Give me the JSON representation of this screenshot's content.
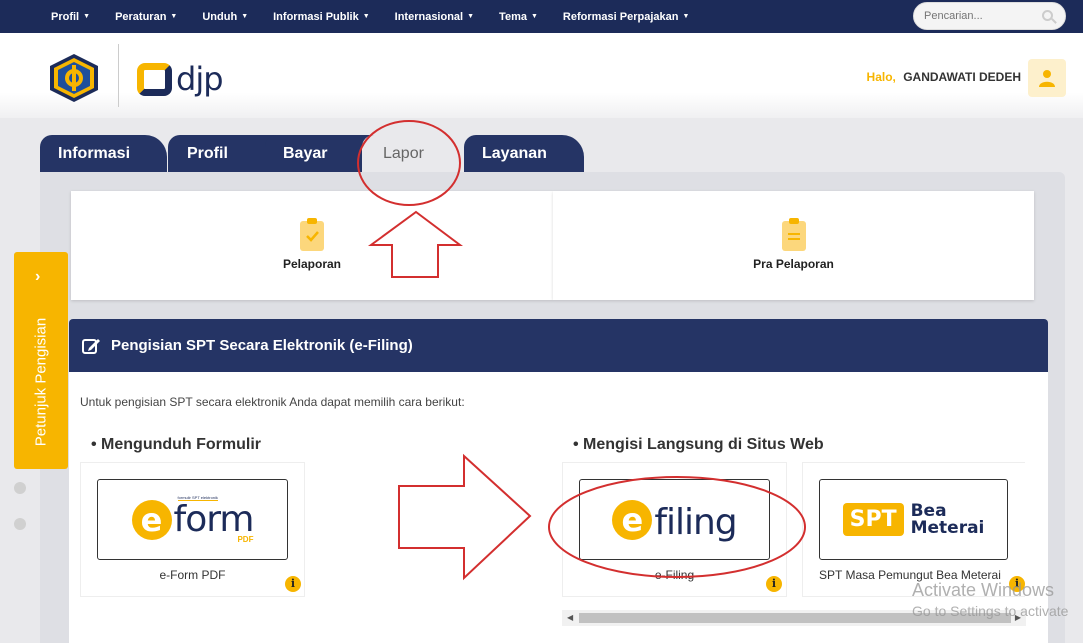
{
  "topnav": {
    "items": [
      "Profil",
      "Peraturan",
      "Unduh",
      "Informasi Publik",
      "Internasional",
      "Tema",
      "Reformasi Perpajakan"
    ],
    "search_placeholder": "Pencarian..."
  },
  "header": {
    "logo_text": "djp",
    "greeting": "Halo,",
    "user_name": "GANDAWATI DEDEH"
  },
  "tabs": [
    "Informasi",
    "Profil",
    "Bayar",
    "Lapor",
    "Layanan"
  ],
  "active_tab": "Lapor",
  "cards": [
    {
      "label": "Pelaporan",
      "icon": "clipboard-check-icon"
    },
    {
      "label": "Pra Pelaporan",
      "icon": "clipboard-list-icon"
    }
  ],
  "section": {
    "title": "Pengisian SPT Secara Elektronik (e-Filing)",
    "intro": "Untuk pengisian SPT secara elektronik Anda dapat memilih cara berikut:",
    "download_heading": "• Mengunduh Formulir",
    "web_heading": "• Mengisi Langsung di Situs Web"
  },
  "options": {
    "eform": {
      "logo_word": "form",
      "logo_tag": "formulir SPT elektronik",
      "logo_sub": "PDF",
      "caption": "e-Form PDF"
    },
    "efiling": {
      "logo_word": "filing",
      "caption": "e-Filing"
    },
    "spt": {
      "chip": "SPT",
      "line1": "Bea",
      "line2": "Meterai",
      "caption": "SPT Masa Pemungut Bea Meterai"
    }
  },
  "sidebar_tab": {
    "label": "Petunjuk Pengisian"
  },
  "watermark": {
    "line1": "Activate Windows",
    "line2": "Go to Settings to activate"
  },
  "colors": {
    "navy": "#1c2b59",
    "accent": "#f7b500",
    "annotation": "#d32f2f"
  }
}
